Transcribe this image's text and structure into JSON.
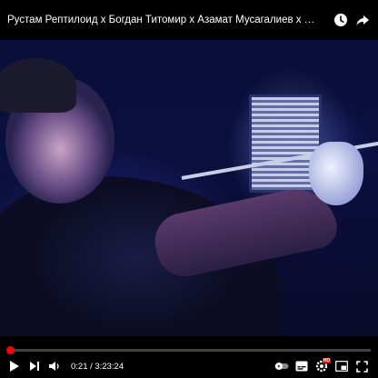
{
  "video": {
    "title": "Рустам Рептилоид х Богдан Титомир х Азамат Мусагалиев х Денис Дорохов х Джиган | ЧТО БЫЛО ДАЛЬШЕ?"
  },
  "player": {
    "current_time": "0:21",
    "duration": "3:23:24",
    "time_separator": " / ",
    "progress_fraction": 0.0017,
    "quality_badge": "HD",
    "accent_color": "#ff0000"
  },
  "icons": {
    "top": [
      "watch-later-icon",
      "share-icon"
    ],
    "left_controls": [
      "play-icon",
      "next-icon",
      "volume-icon"
    ],
    "right_controls": [
      "autoplay-toggle-icon",
      "subtitles-icon",
      "settings-icon",
      "miniplayer-icon",
      "fullscreen-icon"
    ]
  }
}
